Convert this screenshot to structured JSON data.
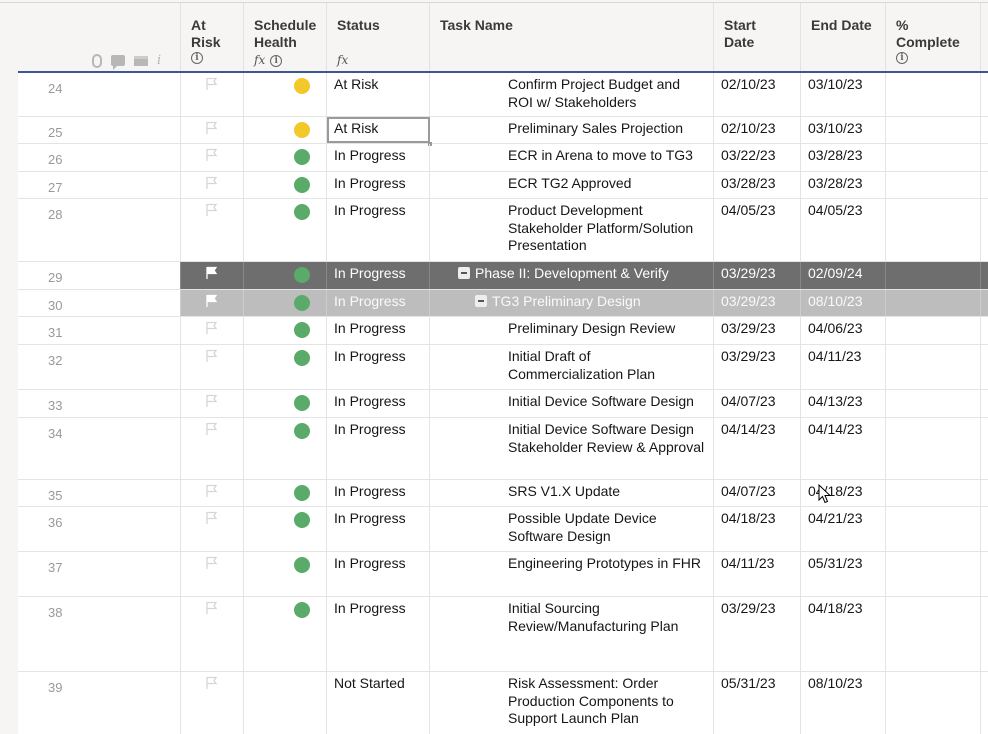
{
  "columns": {
    "at_risk": "At Risk",
    "schedule_health_line1": "Schedule",
    "schedule_health_line2": "Health",
    "status": "Status",
    "task_name": "Task Name",
    "start_date_line1": "Start",
    "start_date_line2": "Date",
    "end_date": "End Date",
    "pct_complete_line1": "%",
    "pct_complete_line2": "Complete"
  },
  "header_icons": [
    "attachment-icon",
    "comment-icon",
    "proofing-icon",
    "info-icon"
  ],
  "colors": {
    "yellow": "#f3c82b",
    "green": "#5aab6a",
    "parent_row": "#6e6e6e",
    "sub_row": "#bdbdbd",
    "header_border": "#3a5795"
  },
  "rows": [
    {
      "num": "24",
      "health": "yellow",
      "status": "At Risk",
      "task": "Confirm Project Budget and ROI w/ Stakeholders",
      "start": "02/10/23",
      "end": "03/10/23",
      "pct": "",
      "indent": 2
    },
    {
      "num": "25",
      "health": "yellow",
      "status": "At Risk",
      "task": "Preliminary Sales Projection",
      "start": "02/10/23",
      "end": "03/10/23",
      "pct": "",
      "indent": 2,
      "selected": true
    },
    {
      "num": "26",
      "health": "green",
      "status": "In Progress",
      "task": "ECR in Arena to move to TG3",
      "start": "03/22/23",
      "end": "03/28/23",
      "pct": "",
      "indent": 2
    },
    {
      "num": "27",
      "health": "green",
      "status": "In Progress",
      "task": "ECR TG2 Approved",
      "start": "03/28/23",
      "end": "03/28/23",
      "pct": "",
      "indent": 2
    },
    {
      "num": "28",
      "health": "green",
      "status": "In Progress",
      "task": "Product Development Stakeholder Platform/Solution Presentation",
      "start": "04/05/23",
      "end": "04/05/23",
      "pct": "",
      "indent": 2
    },
    {
      "num": "29",
      "health": "green",
      "status": "In Progress",
      "task": "Phase II: Development & Verify",
      "start": "03/29/23",
      "end": "02/09/24",
      "pct": "",
      "indent": 0,
      "type": "parent"
    },
    {
      "num": "30",
      "health": "green",
      "status": "In Progress",
      "task": "TG3 Preliminary Design",
      "start": "03/29/23",
      "end": "08/10/23",
      "pct": "",
      "indent": 1,
      "type": "sub"
    },
    {
      "num": "31",
      "health": "green",
      "status": "In Progress",
      "task": "Preliminary Design Review",
      "start": "03/29/23",
      "end": "04/06/23",
      "pct": "",
      "indent": 2
    },
    {
      "num": "32",
      "health": "green",
      "status": "In Progress",
      "task": "Initial Draft of Commercialization Plan",
      "start": "03/29/23",
      "end": "04/11/23",
      "pct": "",
      "indent": 2
    },
    {
      "num": "33",
      "health": "green",
      "status": "In Progress",
      "task": "Initial Device Software Design",
      "start": "04/07/23",
      "end": "04/13/23",
      "pct": "",
      "indent": 2
    },
    {
      "num": "34",
      "health": "green",
      "status": "In Progress",
      "task": "Initial Device Software Design Stakeholder Review & Approval",
      "start": "04/14/23",
      "end": "04/14/23",
      "pct": "",
      "indent": 2
    },
    {
      "num": "35",
      "health": "green",
      "status": "In Progress",
      "task": "SRS V1.X Update",
      "start": "04/07/23",
      "end": "04/18/23",
      "pct": "",
      "indent": 2
    },
    {
      "num": "36",
      "health": "green",
      "status": "In Progress",
      "task": "Possible Update Device Software Design",
      "start": "04/18/23",
      "end": "04/21/23",
      "pct": "",
      "indent": 2
    },
    {
      "num": "37",
      "health": "green",
      "status": "In Progress",
      "task": "Engineering Prototypes in FHR",
      "start": "04/11/23",
      "end": "05/31/23",
      "pct": "",
      "indent": 2
    },
    {
      "num": "38",
      "health": "green",
      "status": "In Progress",
      "task": "Initial Sourcing Review/Manufacturing Plan",
      "start": "03/29/23",
      "end": "04/18/23",
      "pct": "",
      "indent": 2
    },
    {
      "num": "39",
      "health": "",
      "status": "Not Started",
      "task": "Risk Assessment: Order Production Components to Support Launch Plan",
      "start": "05/31/23",
      "end": "08/10/23",
      "pct": "",
      "indent": 2
    }
  ]
}
